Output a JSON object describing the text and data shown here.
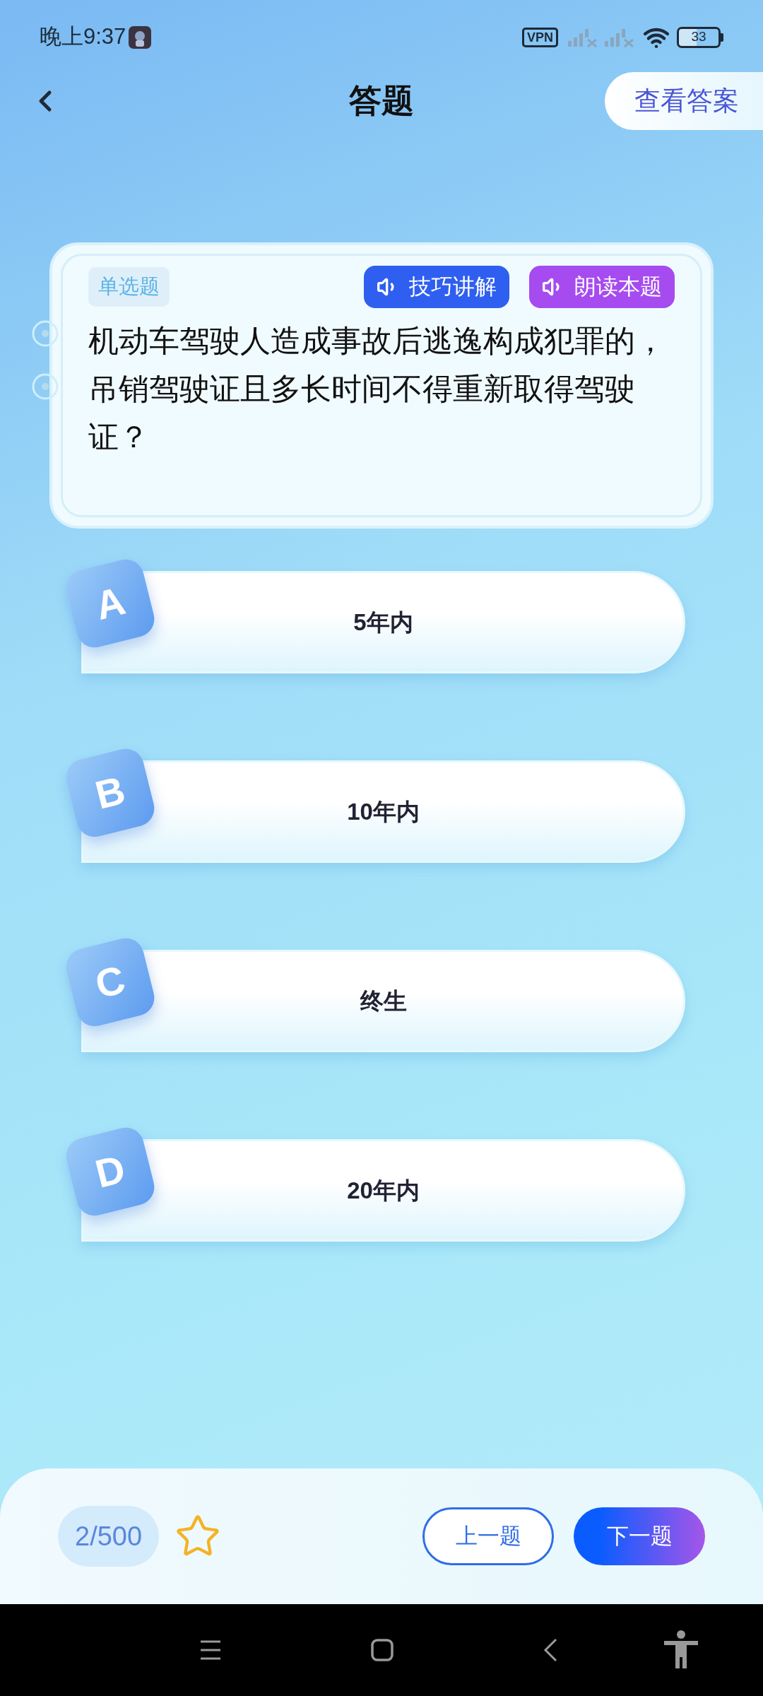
{
  "status_bar": {
    "time": "晚上9:37",
    "vpn": "VPN",
    "battery": "33"
  },
  "header": {
    "title": "答题",
    "answer_button": "查看答案"
  },
  "question": {
    "type_tag": "单选题",
    "buttons": [
      {
        "label": "技巧讲解",
        "kind": "tips"
      },
      {
        "label": "朗读本题",
        "kind": "read"
      }
    ],
    "text": "机动车驾驶人造成事故后逃逸构成犯罪的，吊销驾驶证且多长时间不得重新取得驾驶证？"
  },
  "options": [
    {
      "letter": "A",
      "text": "5年内",
      "selected": false
    },
    {
      "letter": "B",
      "text": "10年内",
      "selected": false
    },
    {
      "letter": "C",
      "text": "终生",
      "selected": false
    },
    {
      "letter": "D",
      "text": "20年内",
      "selected": false
    }
  ],
  "footer": {
    "progress": "2/500",
    "starred": false,
    "prev": "上一题",
    "next": "下一题"
  }
}
